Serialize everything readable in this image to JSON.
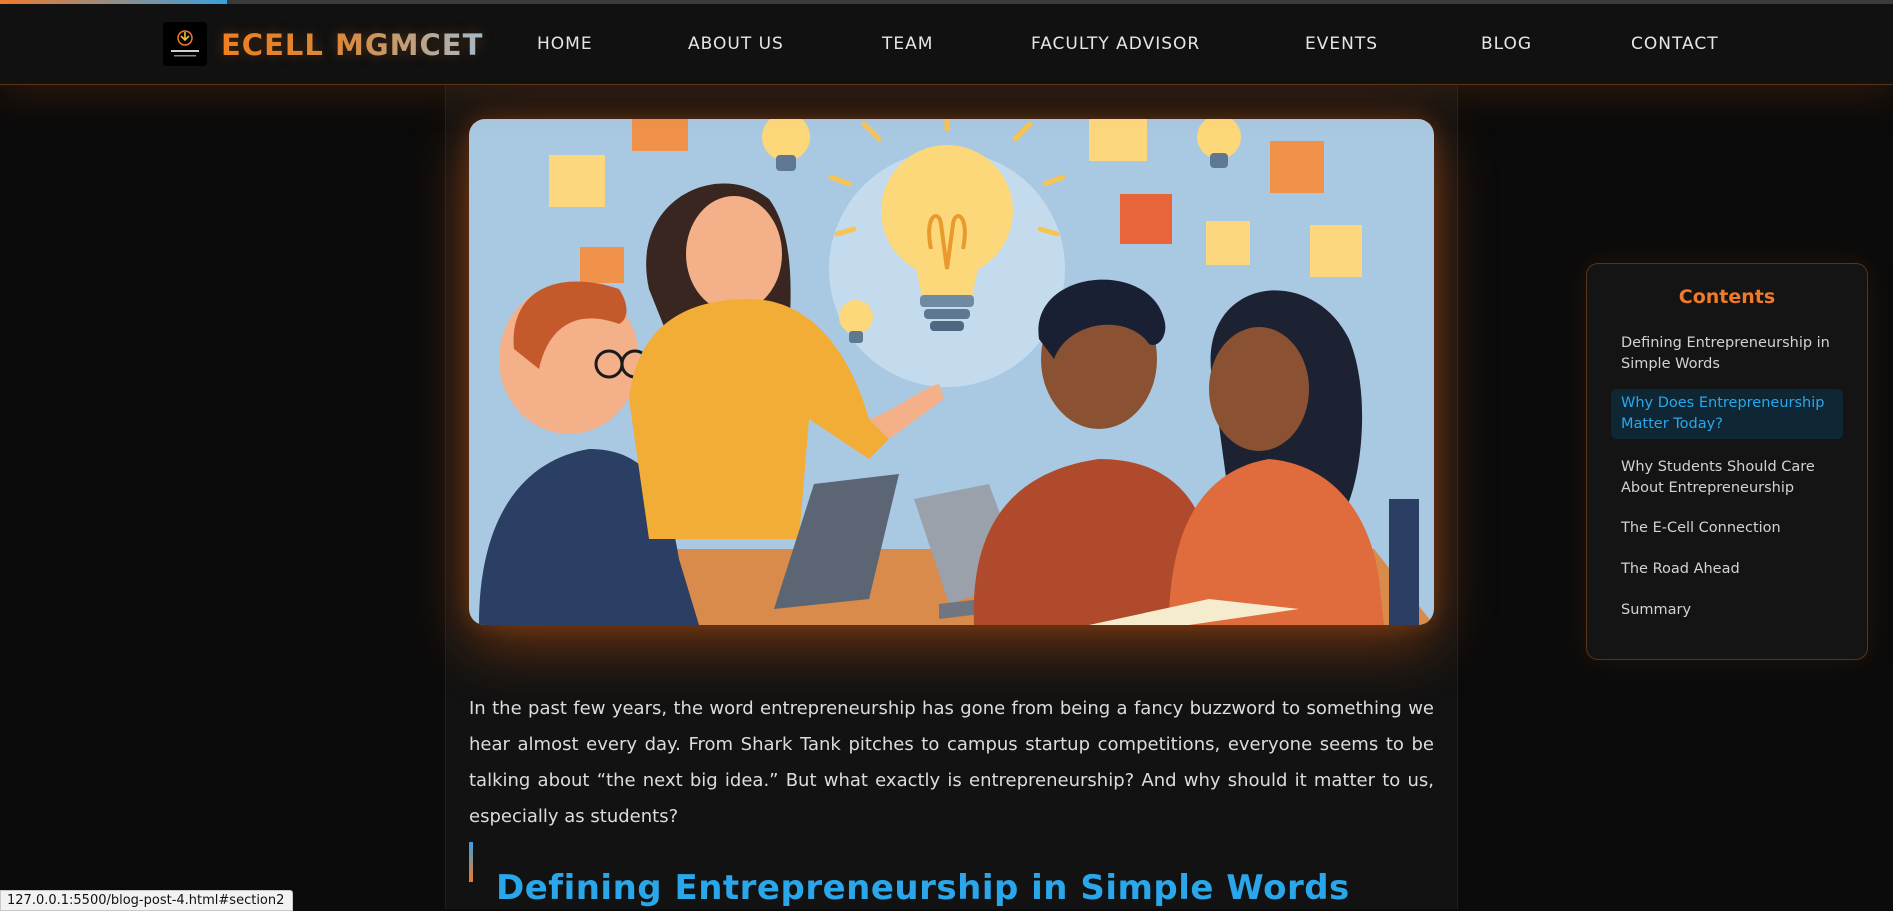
{
  "progress": {
    "fraction": 0.12
  },
  "brand": {
    "name": "ECELL MGMCET",
    "logo": "ecell-logo-icon"
  },
  "nav": {
    "items": [
      {
        "label": "HOME"
      },
      {
        "label": "ABOUT US"
      },
      {
        "label": "TEAM"
      },
      {
        "label": "FACULTY ADVISOR"
      },
      {
        "label": "EVENTS"
      },
      {
        "label": "BLOG"
      },
      {
        "label": "CONTACT"
      }
    ]
  },
  "article": {
    "hero_image": "team-brainstorm-lightbulb-illustration",
    "intro": "In the past few years, the word entrepreneurship has gone from being a fancy buzzword to something we hear almost every day. From Shark Tank pitches to campus startup competitions, everyone seems to be talking about “the next big idea.” But what exactly is entrepreneurship? And why should it matter to us, especially as students?",
    "section_heading": "Defining Entrepreneurship in Simple Words"
  },
  "toc": {
    "title": "Contents",
    "items": [
      {
        "label": "Defining Entrepreneurship in Simple Words",
        "active": false
      },
      {
        "label": "Why Does Entrepreneurship Matter Today?",
        "active": true
      },
      {
        "label": "Why Students Should Care About Entrepreneurship",
        "active": false
      },
      {
        "label": "The E-Cell Connection",
        "active": false
      },
      {
        "label": "The Road Ahead",
        "active": false
      },
      {
        "label": "Summary",
        "active": false
      }
    ]
  },
  "status_bar": {
    "url": "127.0.0.1:5500/blog-post-4.html#section2"
  },
  "colors": {
    "accent_orange": "#f07a2a",
    "accent_blue": "#2aa7ea",
    "background": "#0b0b0b",
    "panel": "#121212"
  }
}
